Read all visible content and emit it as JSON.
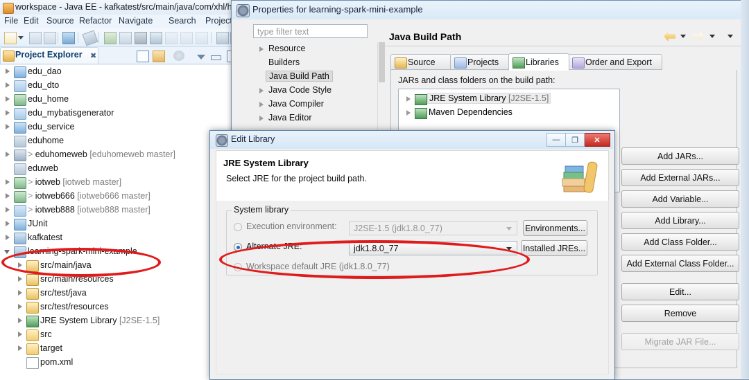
{
  "eclipse": {
    "title": "workspace - Java EE - kafkatest/src/main/java/com/xhl/ha",
    "app_icon": "eclipse-icon",
    "window_buttons": [
      {
        "name": "minimize-button",
        "glyph": "—"
      },
      {
        "name": "maximize-button",
        "glyph": "❐"
      },
      {
        "name": "close-button",
        "glyph": "✕"
      }
    ],
    "menus": [
      "File",
      "Edit",
      "Source",
      "Refactor",
      "Navigate",
      "Search",
      "Project"
    ],
    "toolbar_icons": [
      "new-icon",
      "new-dropdown-icon",
      "save-icon",
      "save-all-icon",
      "console-icon",
      "no-marker-icon",
      "run-icon",
      "split-icon",
      "terminate-icon",
      "link-icon",
      "debug1-icon",
      "debug2-icon",
      "debug3-icon",
      "sort-icon",
      "extra-icon"
    ]
  },
  "project_explorer": {
    "tab_label": "Project Explorer",
    "tab_icon": "explorer-icon",
    "close_icon": "close-tab-icon",
    "toolbar_icons": [
      "collapse-all-icon",
      "link-with-editor-icon",
      "focus-icon",
      "view-menu-icon",
      "minimize-view-icon",
      "maximize-view-icon"
    ],
    "items": [
      {
        "label": "edu_dao",
        "icon": "java-project-icon",
        "indent": 0,
        "twisty": "closed",
        "suffix": "",
        "prefix": ""
      },
      {
        "label": "edu_dto",
        "icon": "project-icon",
        "indent": 0,
        "twisty": "closed",
        "suffix": "",
        "prefix": ""
      },
      {
        "label": "edu_home",
        "icon": "web-project-icon",
        "indent": 0,
        "twisty": "closed",
        "suffix": "",
        "prefix": ""
      },
      {
        "label": "edu_mybatisgenerator",
        "icon": "project-icon",
        "indent": 0,
        "twisty": "closed",
        "suffix": "",
        "prefix": ""
      },
      {
        "label": "edu_service",
        "icon": "java-project-icon",
        "indent": 0,
        "twisty": "closed",
        "suffix": "",
        "prefix": ""
      },
      {
        "label": "eduhome",
        "icon": "closed-project-icon",
        "indent": 0,
        "twisty": "none",
        "suffix": "",
        "prefix": ""
      },
      {
        "label": "eduhomeweb",
        "icon": "maven-web-project-icon",
        "indent": 0,
        "twisty": "closed",
        "suffix": "[eduhomeweb master]",
        "prefix": ">"
      },
      {
        "label": "eduweb",
        "icon": "closed-project-icon",
        "indent": 0,
        "twisty": "none",
        "suffix": "",
        "prefix": ""
      },
      {
        "label": "iotweb",
        "icon": "web-project-icon",
        "indent": 0,
        "twisty": "closed",
        "suffix": "[iotweb master]",
        "prefix": ">"
      },
      {
        "label": "iotweb666",
        "icon": "web-project-icon",
        "indent": 0,
        "twisty": "closed",
        "suffix": "[iotweb666 master]",
        "prefix": ">"
      },
      {
        "label": "iotweb888",
        "icon": "project-icon",
        "indent": 0,
        "twisty": "closed",
        "suffix": "[iotweb888 master]",
        "prefix": ">"
      },
      {
        "label": "JUnit",
        "icon": "java-project-icon",
        "indent": 0,
        "twisty": "closed",
        "suffix": "",
        "prefix": ""
      },
      {
        "label": "kafkatest",
        "icon": "maven-java-project-icon",
        "indent": 0,
        "twisty": "closed",
        "suffix": "",
        "prefix": ""
      },
      {
        "label": "learning-spark-mini-example",
        "icon": "maven-java-project-icon",
        "indent": 0,
        "twisty": "open",
        "suffix": "",
        "prefix": ""
      },
      {
        "label": "src/main/java",
        "icon": "source-folder-icon",
        "indent": 1,
        "twisty": "closed",
        "suffix": "",
        "prefix": ""
      },
      {
        "label": "src/main/resources",
        "icon": "source-folder-icon",
        "indent": 1,
        "twisty": "closed",
        "suffix": "",
        "prefix": ""
      },
      {
        "label": "src/test/java",
        "icon": "source-folder-icon",
        "indent": 1,
        "twisty": "closed",
        "suffix": "",
        "prefix": ""
      },
      {
        "label": "src/test/resources",
        "icon": "source-folder-icon",
        "indent": 1,
        "twisty": "closed",
        "suffix": "",
        "prefix": ""
      },
      {
        "label": "JRE System Library",
        "icon": "library-icon",
        "indent": 1,
        "twisty": "closed",
        "suffix": "[J2SE-1.5]",
        "prefix": ""
      },
      {
        "label": "src",
        "icon": "folder-icon",
        "indent": 1,
        "twisty": "closed",
        "suffix": "",
        "prefix": ""
      },
      {
        "label": "target",
        "icon": "folder-icon",
        "indent": 1,
        "twisty": "closed",
        "suffix": "",
        "prefix": ""
      },
      {
        "label": "pom.xml",
        "icon": "xml-file-icon",
        "indent": 1,
        "twisty": "none",
        "suffix": "",
        "prefix": ""
      }
    ]
  },
  "properties_dialog": {
    "title": "Properties for learning-spark-mini-example",
    "icon": "properties-icon",
    "filter_placeholder": "type filter text",
    "filter_value": "",
    "tree_items": [
      {
        "label": "Resource",
        "twisty": true,
        "selected": false
      },
      {
        "label": "Builders",
        "twisty": false,
        "selected": false
      },
      {
        "label": "Java Build Path",
        "twisty": false,
        "selected": true
      },
      {
        "label": "Java Code Style",
        "twisty": true,
        "selected": false
      },
      {
        "label": "Java Compiler",
        "twisty": true,
        "selected": false
      },
      {
        "label": "Java Editor",
        "twisty": true,
        "selected": false
      }
    ],
    "page_title": "Java Build Path",
    "nav": {
      "back_icon": "back-arrow-icon",
      "back_caret": "chevron-down-icon",
      "forward_icon": "forward-arrow-icon",
      "forward_caret": "chevron-down-icon",
      "menu_caret": "chevron-down-icon"
    },
    "tabs": [
      {
        "label": "Source",
        "icon": "source-folder-icon",
        "active": false
      },
      {
        "label": "Projects",
        "icon": "projects-icon",
        "active": false
      },
      {
        "label": "Libraries",
        "icon": "library-icon",
        "active": true
      },
      {
        "label": "Order and Export",
        "icon": "order-export-icon",
        "active": false
      }
    ],
    "jars_label": "JARs and class folders on the build path:",
    "jars_items": [
      {
        "label": "JRE System Library",
        "suffix": "[J2SE-1.5]",
        "icon": "library-icon",
        "selected": true
      },
      {
        "label": "Maven Dependencies",
        "suffix": "",
        "icon": "library-icon",
        "selected": false
      }
    ],
    "buttons": [
      {
        "label": "Add JARs...",
        "enabled": true
      },
      {
        "label": "Add External JARs...",
        "enabled": true
      },
      {
        "label": "Add Variable...",
        "enabled": true
      },
      {
        "label": "Add Library...",
        "enabled": true
      },
      {
        "label": "Add Class Folder...",
        "enabled": true
      },
      {
        "label": "Add External Class Folder...",
        "enabled": true
      },
      {
        "label": "Edit...",
        "enabled": true
      },
      {
        "label": "Remove",
        "enabled": true
      },
      {
        "label": "Migrate JAR File...",
        "enabled": false
      }
    ]
  },
  "edit_library_dialog": {
    "title": "Edit Library",
    "icon": "properties-icon",
    "window_buttons": [
      {
        "name": "minimize-button",
        "glyph": "—"
      },
      {
        "name": "maximize-button",
        "glyph": "❐"
      },
      {
        "name": "close-button",
        "glyph": "✕"
      }
    ],
    "header_title": "JRE System Library",
    "header_subtitle": "Select JRE for the project build path.",
    "header_image": "books-icon",
    "group_label": "System library",
    "options": [
      {
        "name": "execution-environment",
        "label": "Execution environment:",
        "checked": false,
        "enabled": false,
        "combo_value": "J2SE-1.5 (jdk1.8.0_77)",
        "button": "Environments..."
      },
      {
        "name": "alternate-jre",
        "label": "Alternate JRE:",
        "checked": true,
        "enabled": true,
        "combo_value": "jdk1.8.0_77",
        "button": "Installed JREs..."
      },
      {
        "name": "workspace-default-jre",
        "label": "Workspace default JRE (jdk1.8.0_77)",
        "checked": false,
        "enabled": false,
        "combo_value": "",
        "button": ""
      }
    ]
  },
  "annotations": {
    "color": "#e01b1b",
    "ellipses": [
      {
        "name": "highlight-project-ellipse"
      },
      {
        "name": "highlight-alternate-jre-ellipse"
      }
    ]
  }
}
